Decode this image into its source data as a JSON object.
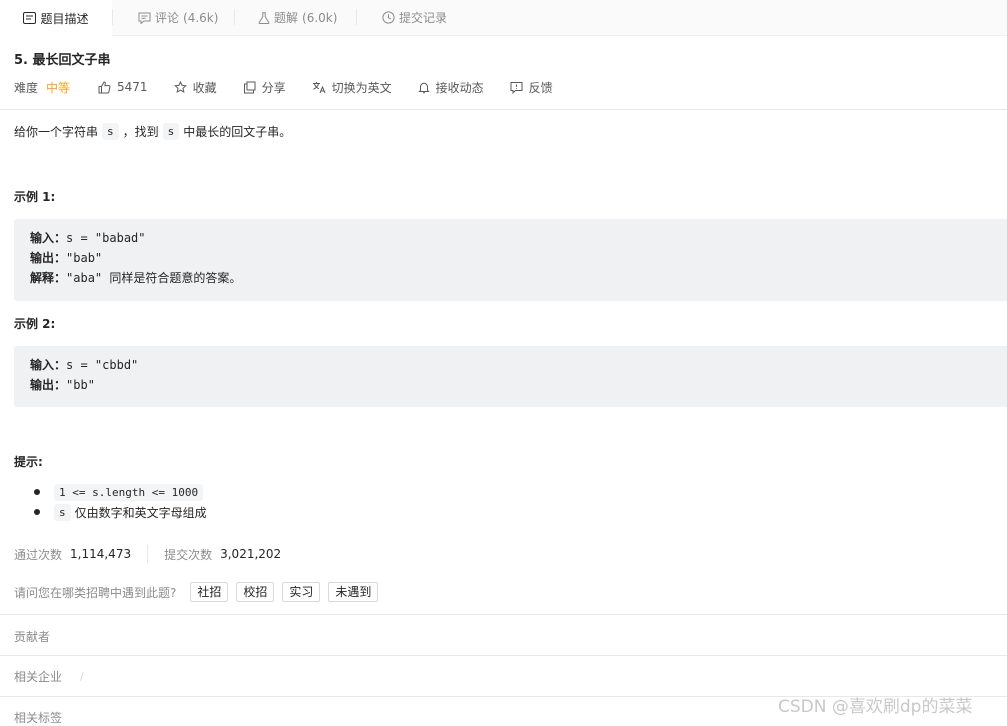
{
  "tabs": [
    {
      "label": "题目描述",
      "count": "",
      "icon": "document-icon",
      "active": true
    },
    {
      "label": "评论",
      "count": "(4.6k)",
      "icon": "comment-icon",
      "active": false
    },
    {
      "label": "题解",
      "count": "(6.0k)",
      "icon": "flask-icon",
      "active": false
    },
    {
      "label": "提交记录",
      "count": "",
      "icon": "clock-icon",
      "active": false
    }
  ],
  "problem": {
    "title": "5. 最长回文子串",
    "difficulty_label": "难度",
    "difficulty_value": "中等",
    "likes": "5471",
    "favorite": "收藏",
    "share": "分享",
    "switch_lang": "切换为英文",
    "notify": "接收动态",
    "feedback": "反馈"
  },
  "description": {
    "part1": "给你一个字符串",
    "code1": "s",
    "part2": "，找到",
    "code2": "s",
    "part3": "中最长的回文子串。"
  },
  "example1": {
    "heading": "示例 1:",
    "input_label": "输入：",
    "input_value": "s = \"babad\"",
    "output_label": "输出：",
    "output_value": "\"bab\"",
    "explain_label": "解释：",
    "explain_value": "\"aba\" 同样是符合题意的答案。"
  },
  "example2": {
    "heading": "示例 2:",
    "input_label": "输入：",
    "input_value": "s = \"cbbd\"",
    "output_label": "输出：",
    "output_value": "\"bb\""
  },
  "hints": {
    "heading": "提示:",
    "item1_code": "1 <= s.length <= 1000",
    "item2_code": "s",
    "item2_text": "仅由数字和英文字母组成"
  },
  "stats": {
    "passed_label": "通过次数",
    "passed_value": "1,114,473",
    "submit_label": "提交次数",
    "submit_value": "3,021,202"
  },
  "interview": {
    "question": "请问您在哪类招聘中遇到此题?",
    "options": [
      "社招",
      "校招",
      "实习",
      "未遇到"
    ]
  },
  "sections": {
    "contributors": "贡献者",
    "companies": "相关企业",
    "companies_sep": "/",
    "tags": "相关标签"
  },
  "watermark": "CSDN @喜欢刷dp的菜菜",
  "colors": {
    "accent_medium": "#ffa116",
    "code_bg": "#f0f1f3"
  }
}
